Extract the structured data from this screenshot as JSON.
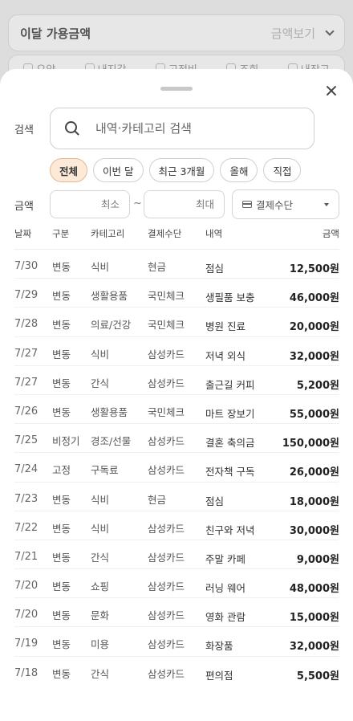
{
  "background": {
    "card_title": "이달 가용금액",
    "card_action": "금액보기",
    "tabs": [
      "요약",
      "내지갑",
      "고정비",
      "조회",
      "내장고"
    ]
  },
  "sheet": {
    "search_label": "검색",
    "search_placeholder": "내역·카테고리 검색",
    "chips": [
      "전체",
      "이번 달",
      "최근 3개월",
      "올해",
      "직접"
    ],
    "active_chip": "전체",
    "amount_label": "금액",
    "min_placeholder": "최소",
    "max_placeholder": "최대",
    "tilde": "~",
    "payment_select": "결제수단",
    "columns": [
      "날짜",
      "구분",
      "카테고리",
      "결제수단",
      "내역",
      "금액"
    ],
    "rows": [
      [
        "7/30",
        "변동",
        "식비",
        "현금",
        "점심",
        "12,500원"
      ],
      [
        "7/29",
        "변동",
        "생활용품",
        "국민체크",
        "생필품 보충",
        "46,000원"
      ],
      [
        "7/28",
        "변동",
        "의료/건강",
        "국민체크",
        "병원 진료",
        "20,000원"
      ],
      [
        "7/27",
        "변동",
        "식비",
        "삼성카드",
        "저녁 외식",
        "32,000원"
      ],
      [
        "7/27",
        "변동",
        "간식",
        "삼성카드",
        "출근길 커피",
        "5,200원"
      ],
      [
        "7/26",
        "변동",
        "생활용품",
        "국민체크",
        "마트 장보기",
        "55,000원"
      ],
      [
        "7/25",
        "비정기",
        "경조/선물",
        "삼성카드",
        "결혼 축의금",
        "150,000원"
      ],
      [
        "7/24",
        "고정",
        "구독료",
        "삼성카드",
        "전자책 구독",
        "26,000원"
      ],
      [
        "7/23",
        "변동",
        "식비",
        "현금",
        "점심",
        "18,000원"
      ],
      [
        "7/22",
        "변동",
        "식비",
        "삼성카드",
        "친구와 저녁",
        "30,000원"
      ],
      [
        "7/21",
        "변동",
        "간식",
        "삼성카드",
        "주말 카페",
        "9,000원"
      ],
      [
        "7/20",
        "변동",
        "쇼핑",
        "삼성카드",
        "러닝 웨어",
        "48,000원"
      ],
      [
        "7/20",
        "변동",
        "문화",
        "삼성카드",
        "영화 관람",
        "15,000원"
      ],
      [
        "7/19",
        "변동",
        "미용",
        "삼성카드",
        "화장품",
        "32,000원"
      ],
      [
        "7/18",
        "변동",
        "간식",
        "삼성카드",
        "편의점",
        "5,500원"
      ]
    ]
  },
  "colors": {
    "active_chip_bg": "#fde9d8",
    "active_chip_border": "#e8b78e"
  }
}
